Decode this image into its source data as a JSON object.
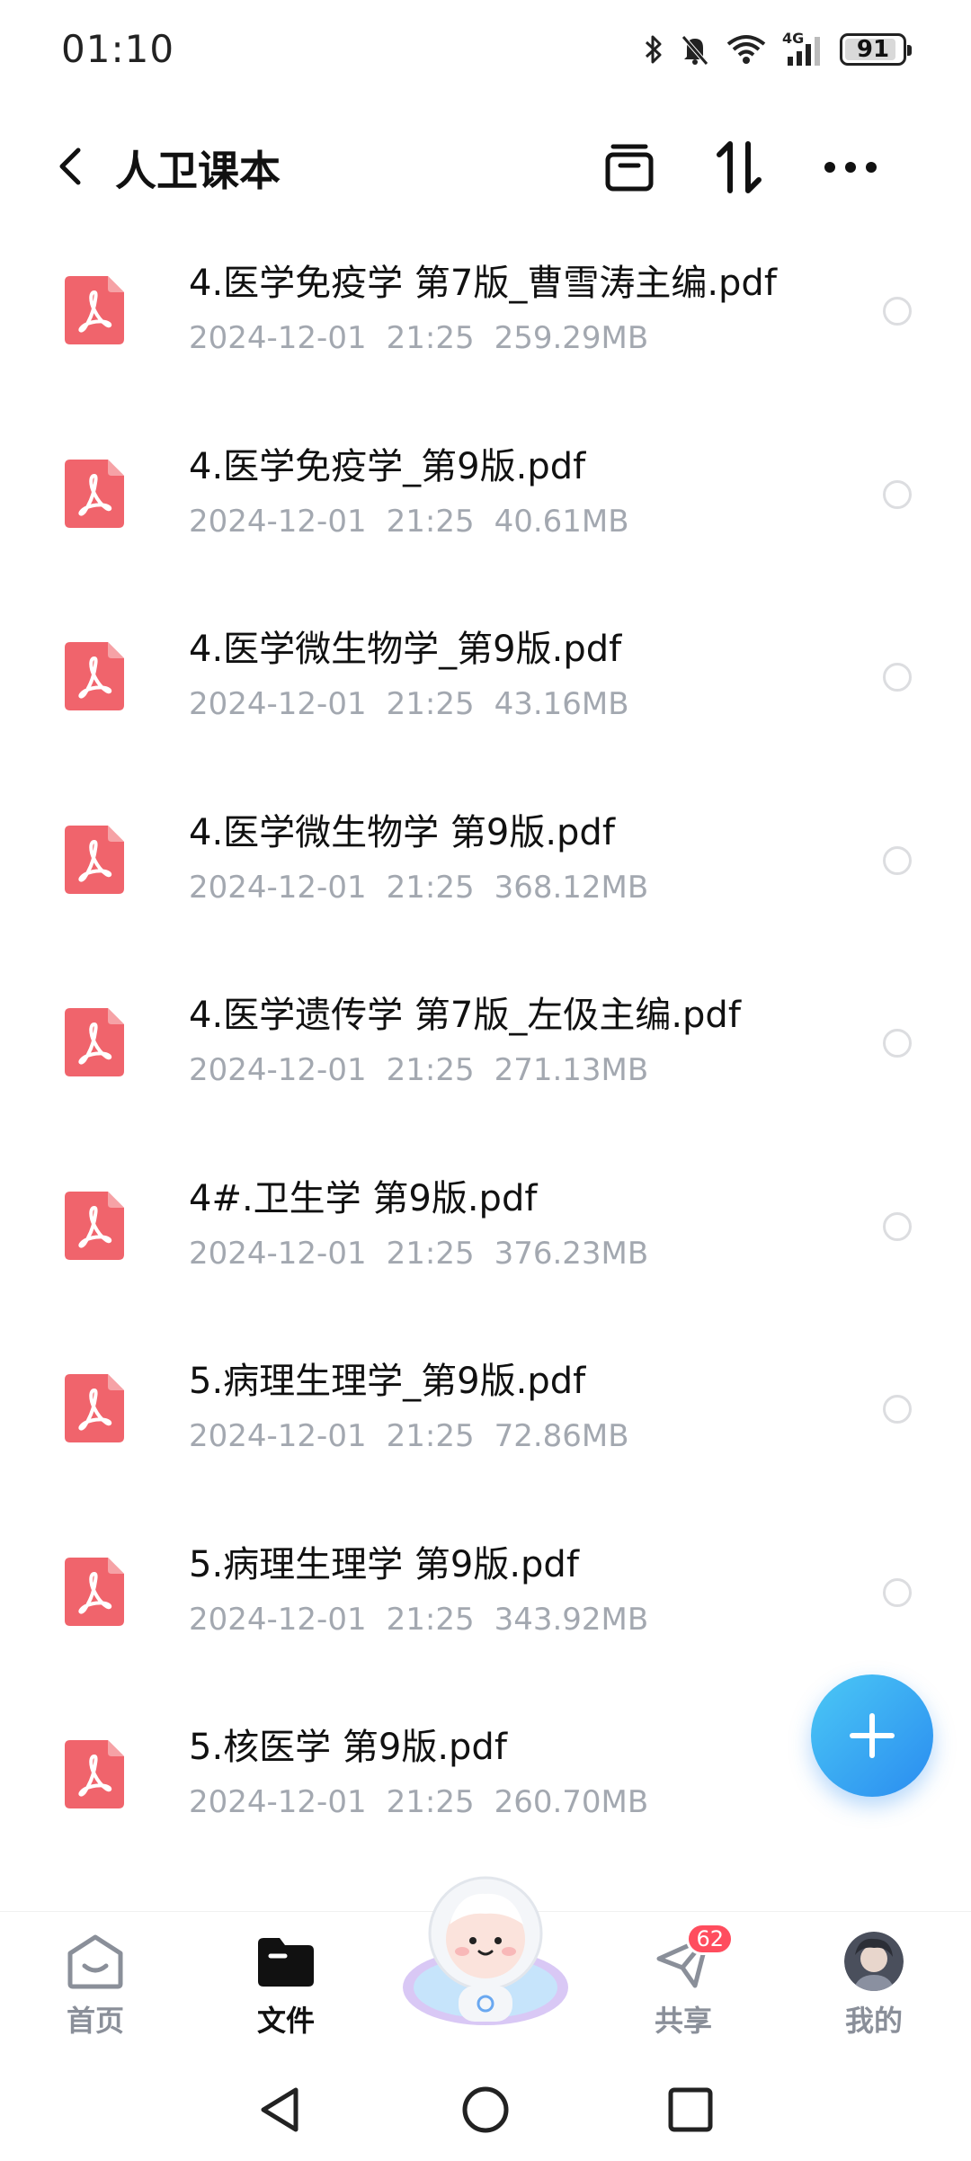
{
  "status_bar": {
    "time": "01:10",
    "battery": "91",
    "battery_level": 0.91,
    "network": "4G",
    "icons": [
      "bluetooth-icon",
      "bell-muted-icon",
      "wifi-icon",
      "cell-signal-icon",
      "battery-icon"
    ]
  },
  "header": {
    "title": "人卫课本",
    "icons": [
      "back-icon",
      "archive-icon",
      "sort-icon",
      "more-icon"
    ]
  },
  "files": [
    {
      "name": "4.医学免疫学 第7版_曹雪涛主编.pdf",
      "date": "2024-12-01",
      "time": "21:25",
      "size": "259.29MB"
    },
    {
      "name": "4.医学免疫学_第9版.pdf",
      "date": "2024-12-01",
      "time": "21:25",
      "size": "40.61MB"
    },
    {
      "name": "4.医学微生物学_第9版.pdf",
      "date": "2024-12-01",
      "time": "21:25",
      "size": "43.16MB"
    },
    {
      "name": "4.医学微生物学 第9版.pdf",
      "date": "2024-12-01",
      "time": "21:25",
      "size": "368.12MB"
    },
    {
      "name": "4.医学遗传学 第7版_左伋主编.pdf",
      "date": "2024-12-01",
      "time": "21:25",
      "size": "271.13MB"
    },
    {
      "name": "4#.卫生学 第9版.pdf",
      "date": "2024-12-01",
      "time": "21:25",
      "size": "376.23MB"
    },
    {
      "name": "5.病理生理学_第9版.pdf",
      "date": "2024-12-01",
      "time": "21:25",
      "size": "72.86MB"
    },
    {
      "name": "5.病理生理学 第9版.pdf",
      "date": "2024-12-01",
      "time": "21:25",
      "size": "343.92MB"
    },
    {
      "name": "5.核医学 第9版.pdf",
      "date": "2024-12-01",
      "time": "21:25",
      "size": "260.70MB"
    }
  ],
  "fab": {
    "icon": "plus-icon"
  },
  "bottom_nav": {
    "home": "首页",
    "files": "文件",
    "share": "共享",
    "share_badge": "62",
    "mine": "我的",
    "active": "files"
  },
  "colors": {
    "accent": "#2a8cf0",
    "pdf_icon": "#f0646c",
    "meta_text": "#a3a8b0",
    "badge": "#ff4d5e"
  }
}
